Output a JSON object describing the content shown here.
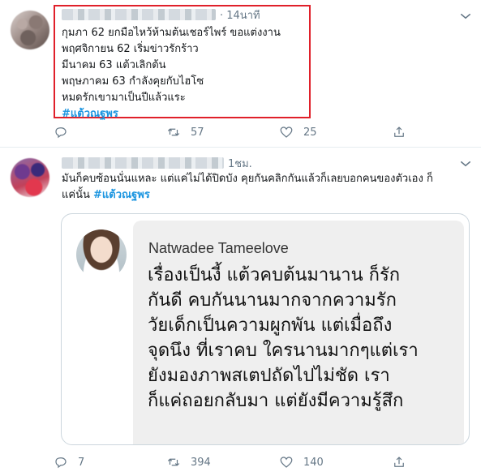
{
  "tweet1": {
    "time": "· 14นาที",
    "lines": [
      "กุมภา 62 ยกมือไหว้ห้ามต้นเชอร์ไพร์ ขอแต่งงาน",
      "พฤศจิกายน 62 เริ่มข่าวรักร้าว",
      "มีนาคม 63 แต้วเลิกต้น",
      "พฤษภาคม 63 กำลังคุยกับไฮโซ",
      "หมดรักเขามาเป็นปีแล้วแระ"
    ],
    "hashtag": "#แต้วณฐพร",
    "actions": {
      "reply": "",
      "retweet": "57",
      "like": "25"
    }
  },
  "tweet2": {
    "time": "1ชม.",
    "lines": [
      "มันก็คบซ้อนนั่นแหละ แต่แค่ไม่ได้ปิดบัง คุยกันคลิกกันแล้วก็เลยบอกคนของตัวเอง ก็",
      "แค่นั้น"
    ],
    "hashtag": "#แต้วณฐพร",
    "embed": {
      "name": "Natwadee Tameelove",
      "text": [
        "เรื่องเป็นงี้ แต้วคบต้นมานาน ก็รัก",
        "กันดี คบกันนานมากจากความรัก",
        "วัยเด็กเป็นความผูกพัน แต่เมื่อถึง",
        "จุดนึง ที่เราคบ ใครนานมากๆแต่เรา",
        "ยังมองภาพสเตปถัดไปไม่ชัด เรา",
        "ก็แค่ถอยกลับมา แต่ยังมีความรู้สึก"
      ]
    },
    "actions": {
      "reply": "7",
      "retweet": "394",
      "like": "140"
    }
  },
  "colors": {
    "hashtag": "#1b95e0",
    "highlight": "#e0202a",
    "meta": "#657786"
  },
  "icons": [
    "chevron-down-icon",
    "reply-icon",
    "retweet-icon",
    "like-icon",
    "share-icon"
  ]
}
